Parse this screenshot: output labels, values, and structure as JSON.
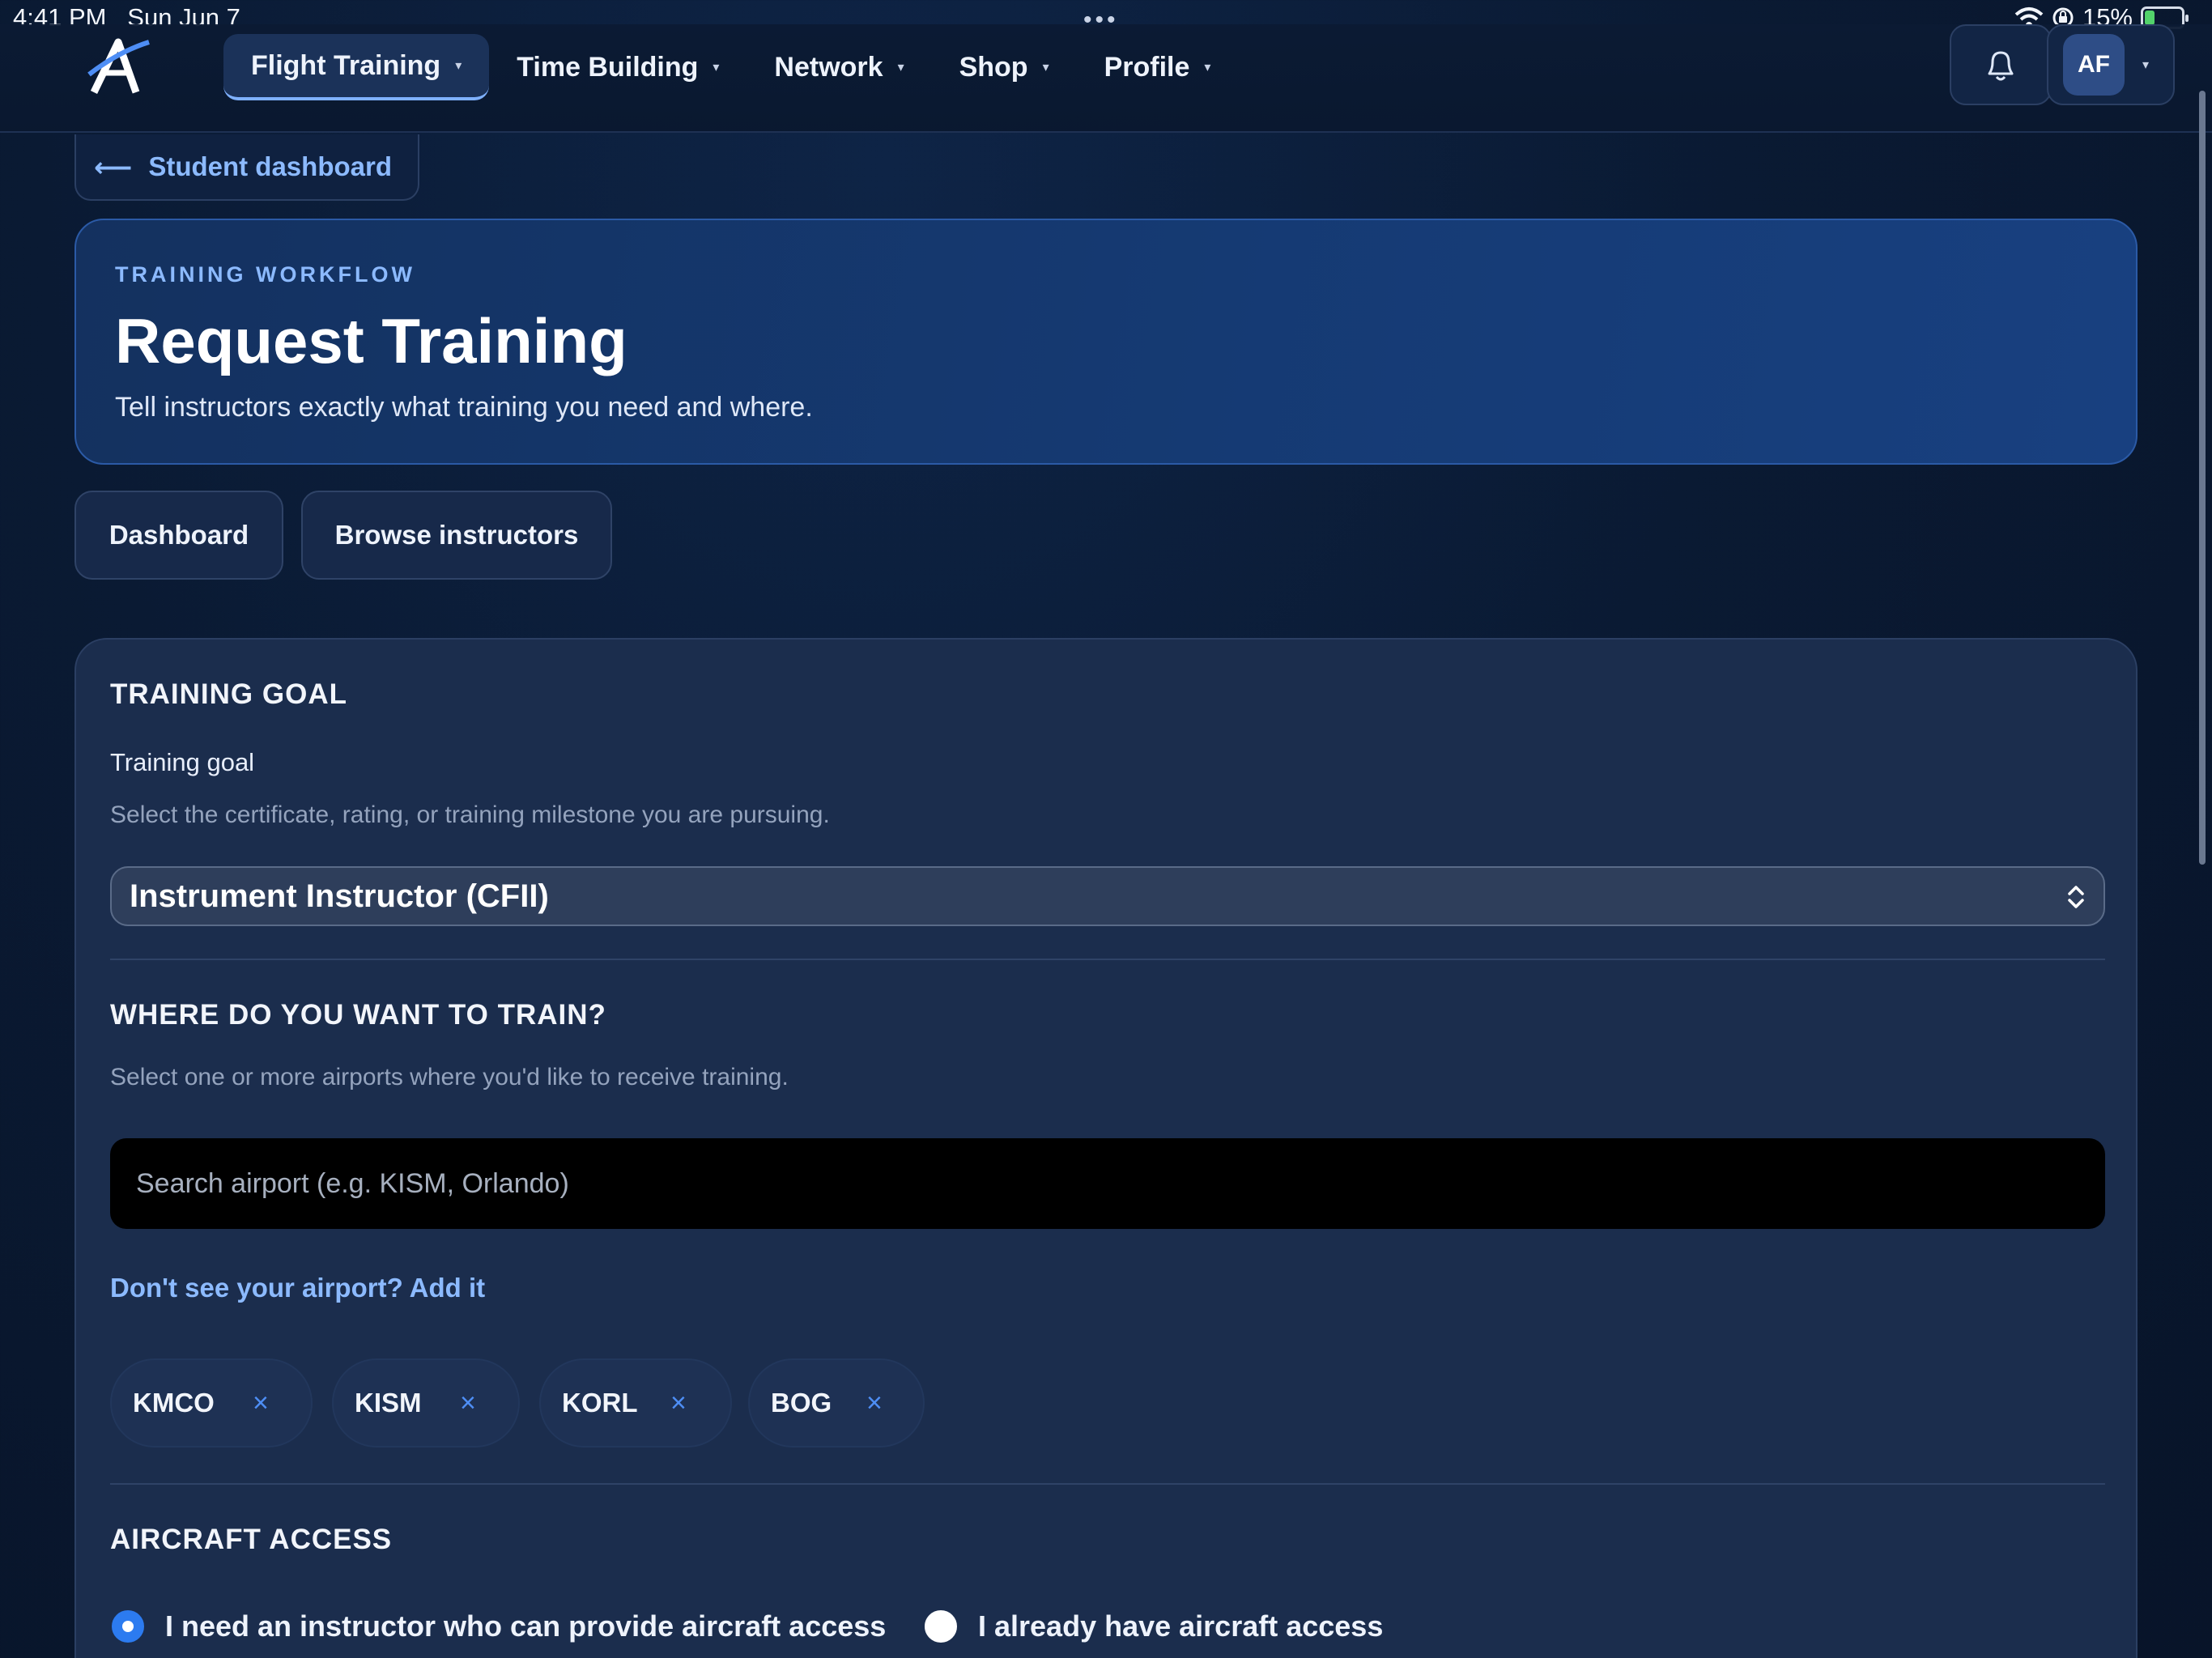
{
  "status_bar": {
    "time": "4:41 PM",
    "date": "Sun Jun 7",
    "dots": "•••",
    "battery": "15%"
  },
  "nav": {
    "items": [
      {
        "label": "Flight Training",
        "active": true
      },
      {
        "label": "Time Building"
      },
      {
        "label": "Network"
      },
      {
        "label": "Shop"
      },
      {
        "label": "Profile"
      }
    ],
    "caret": "▾",
    "avatar_initials": "AF"
  },
  "back_link": {
    "arrow": "⟵",
    "label": "Student dashboard"
  },
  "hero": {
    "eyebrow": "TRAINING WORKFLOW",
    "title": "Request Training",
    "subtitle": "Tell instructors exactly what training you need and where."
  },
  "quick_actions": {
    "dashboard": "Dashboard",
    "browse": "Browse instructors"
  },
  "form": {
    "goal_section_title": "TRAINING GOAL",
    "goal_label": "Training goal",
    "goal_help": "Select the certificate, rating, or training milestone you are pursuing.",
    "goal_selected": "Instrument Instructor (CFII)",
    "where_title": "WHERE DO YOU WANT TO TRAIN?",
    "where_help": "Select one or more airports where you'd like to receive training.",
    "search_placeholder": "Search airport (e.g. KISM, Orlando)",
    "add_airport_link": "Don't see your airport? Add it",
    "airports": [
      "KMCO",
      "KISM",
      "KORL",
      "BOG"
    ],
    "remove_glyph": "×",
    "aircraft_title": "AIRCRAFT ACCESS",
    "aircraft_options": [
      {
        "label": "I need an instructor who can provide aircraft access",
        "checked": true
      },
      {
        "label": "I already have aircraft access",
        "checked": false
      }
    ]
  },
  "colors": {
    "accent": "#8cbaff",
    "radio_checked": "#2c7bf0",
    "chip_remove": "#4e8ef5"
  }
}
